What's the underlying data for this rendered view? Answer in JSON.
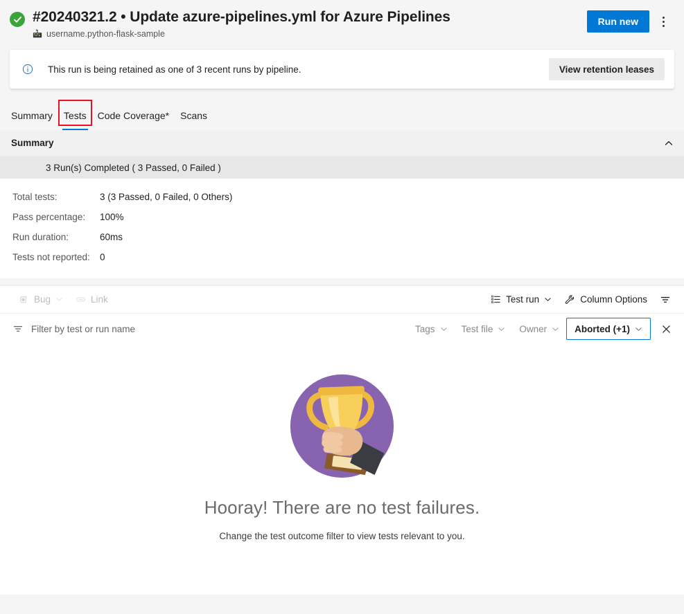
{
  "header": {
    "status_icon": "check-circle-icon",
    "run_title": "#20240321.2 • Update azure-pipelines.yml for Azure Pipelines",
    "repo_icon": "repository-icon",
    "repo_name": "username.python-flask-sample",
    "run_new_label": "Run new",
    "more_actions_icon": "more-vertical-icon"
  },
  "notice": {
    "icon": "info-icon",
    "text": "This run is being retained as one of 3 recent runs by pipeline.",
    "action_label": "View retention leases"
  },
  "tabs": [
    {
      "label": "Summary",
      "active": false
    },
    {
      "label": "Tests",
      "active": true,
      "annotated": true
    },
    {
      "label": "Code Coverage*",
      "active": false
    },
    {
      "label": "Scans",
      "active": false
    }
  ],
  "summary": {
    "title": "Summary",
    "collapse_icon": "chevron-up-icon",
    "runs_line": "3 Run(s) Completed ( 3 Passed, 0 Failed )",
    "stats": [
      {
        "label": "Total tests:",
        "value": "3 (3 Passed, 0 Failed, 0 Others)"
      },
      {
        "label": "Pass percentage:",
        "value": "100%"
      },
      {
        "label": "Run duration:",
        "value": "60ms"
      },
      {
        "label": "Tests not reported:",
        "value": "0"
      }
    ]
  },
  "toolbar": {
    "bug_label": "Bug",
    "bug_icon": "bug-icon",
    "link_label": "Link",
    "link_icon": "link-icon",
    "group_label": "Test run",
    "group_icon": "grouped-list-icon",
    "column_options_label": "Column Options",
    "column_options_icon": "wrench-icon",
    "filter_toggle_icon": "filter-icon"
  },
  "filterbar": {
    "filter_icon": "filter-icon",
    "search_placeholder": "Filter by test or run name",
    "search_value": "",
    "dropdowns": [
      {
        "label": "Tags",
        "selected": false
      },
      {
        "label": "Test file",
        "selected": false
      },
      {
        "label": "Owner",
        "selected": false
      },
      {
        "label": "Aborted (+1)",
        "selected": true
      }
    ],
    "clear_icon": "close-icon"
  },
  "empty_state": {
    "illustration": "trophy-in-hand-illustration",
    "title": "Hooray! There are no test failures.",
    "subtitle": "Change the test outcome filter to view tests relevant to you."
  },
  "colors": {
    "accent": "#0078d4",
    "success": "#3aa33a",
    "annotation": "#e81123",
    "trophy_circle": "#8763b0",
    "trophy_gold": "#f4c64d",
    "page_bg": "#f5f5f5"
  }
}
